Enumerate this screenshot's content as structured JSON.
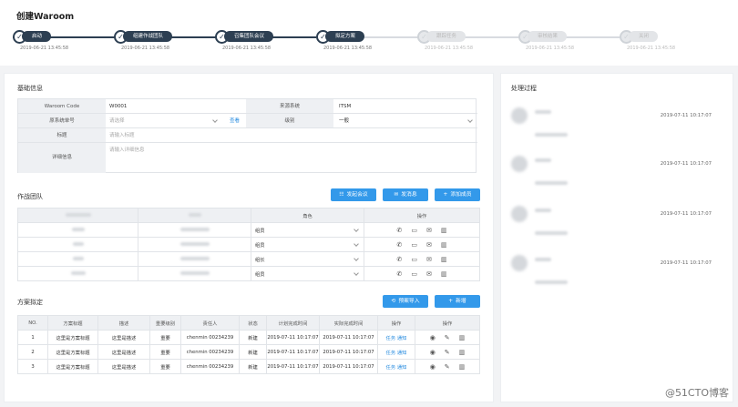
{
  "page": {
    "title": "创建Waroom"
  },
  "steps": [
    {
      "label": "启动",
      "date": "2019-06-21 13:45:58",
      "active": true
    },
    {
      "label": "组建作战团队",
      "date": "2019-06-21 13:45:58",
      "active": true
    },
    {
      "label": "召集团队会议",
      "date": "2019-06-21 13:45:58",
      "active": true
    },
    {
      "label": "拟定方案",
      "date": "2019-06-21 13:45:58",
      "active": true
    },
    {
      "label": "跟踪任务",
      "date": "2019-06-21 13:45:58",
      "active": false
    },
    {
      "label": "审核结果",
      "date": "2019-06-21 13:45:58",
      "active": false
    },
    {
      "label": "关闭",
      "date": "2019-06-21 13:45:58",
      "active": false
    }
  ],
  "basic": {
    "section": "基础信息",
    "code_label": "Waroom Code",
    "code_value": "W0001",
    "source_label": "来源系统",
    "source_value": "ITSM",
    "orig_label": "原系统单号",
    "orig_placeholder": "请选择",
    "view_link": "查看",
    "level_label": "级别",
    "level_value": "一般",
    "title_label": "标题",
    "title_placeholder": "请输入标题",
    "detail_label": "详细信息",
    "detail_placeholder": "请输入详细信息"
  },
  "team": {
    "section": "作战团队",
    "btn_meeting": "发起会议",
    "btn_message": "发消息",
    "btn_add": "添加成员",
    "col_role": "角色",
    "col_ops": "操作",
    "roles": [
      "组员",
      "组员",
      "组长",
      "组员"
    ]
  },
  "plan": {
    "section": "方案拟定",
    "btn_import": "预案导入",
    "btn_new": "新增",
    "headers": [
      "NO.",
      "方案标题",
      "描述",
      "重要级别",
      "责任人",
      "状态",
      "计划完成时间",
      "实际完成时间",
      "操作",
      "操作"
    ],
    "rows": [
      {
        "no": "1",
        "title": "这里是方案标题",
        "desc": "这里是描述",
        "level": "重要",
        "owner": "chenmin 00234239",
        "status": "新建",
        "plan": "2019-07-11 10:17:07",
        "actual": "2019-07-11 10:17:07",
        "task": "任务",
        "notify": "通知"
      },
      {
        "no": "2",
        "title": "这里是方案标题",
        "desc": "这里是描述",
        "level": "重要",
        "owner": "chenmin 00234239",
        "status": "新建",
        "plan": "2019-07-11 10:17:07",
        "actual": "2019-07-11 10:17:07",
        "task": "任务",
        "notify": "通知"
      },
      {
        "no": "3",
        "title": "这里是方案标题",
        "desc": "这里是描述",
        "level": "重要",
        "owner": "chenmin 00234239",
        "status": "新建",
        "plan": "2019-07-11 10:17:07",
        "actual": "2019-07-11 10:17:07",
        "task": "任务",
        "notify": "通知"
      }
    ]
  },
  "process": {
    "section": "处理过程",
    "dates": [
      "2019-07-11 10:17:07",
      "2019-07-11 10:17:07",
      "2019-07-11 10:17:07",
      "2019-07-11 10:17:07"
    ]
  },
  "watermark": "@51CTO博客"
}
